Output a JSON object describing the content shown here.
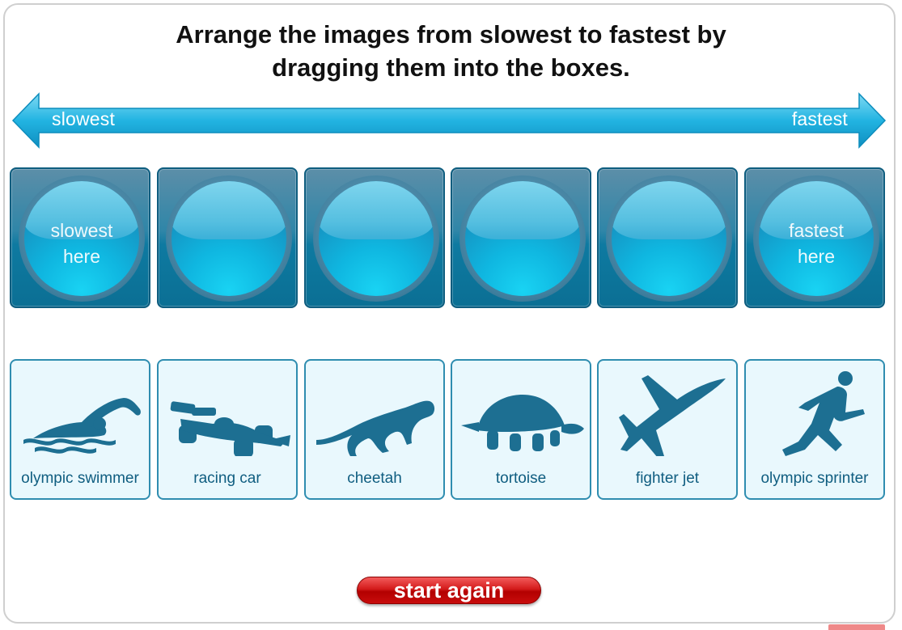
{
  "instruction": {
    "line1": "Arrange the images from slowest to fastest by",
    "line2": "dragging them into the boxes."
  },
  "scale": {
    "left_label": "slowest",
    "right_label": "fastest",
    "color": "#1fb2e0"
  },
  "slots": [
    {
      "hint_line1": "slowest",
      "hint_line2": "here"
    },
    {
      "hint_line1": "",
      "hint_line2": ""
    },
    {
      "hint_line1": "",
      "hint_line2": ""
    },
    {
      "hint_line1": "",
      "hint_line2": ""
    },
    {
      "hint_line1": "",
      "hint_line2": ""
    },
    {
      "hint_line1": "fastest",
      "hint_line2": "here"
    }
  ],
  "cards": [
    {
      "label": "olympic swimmer",
      "icon": "swimmer-icon"
    },
    {
      "label": "racing car",
      "icon": "racing-car-icon"
    },
    {
      "label": "cheetah",
      "icon": "cheetah-icon"
    },
    {
      "label": "tortoise",
      "icon": "tortoise-icon"
    },
    {
      "label": "fighter jet",
      "icon": "fighter-jet-icon"
    },
    {
      "label": "olympic sprinter",
      "icon": "sprinter-icon"
    }
  ],
  "buttons": {
    "start_again": "start again"
  },
  "colors": {
    "slot_blue": "#0e7aa1",
    "card_bg": "#e9f8fd",
    "card_text": "#0f5d80",
    "button_red": "#c80c0c"
  }
}
